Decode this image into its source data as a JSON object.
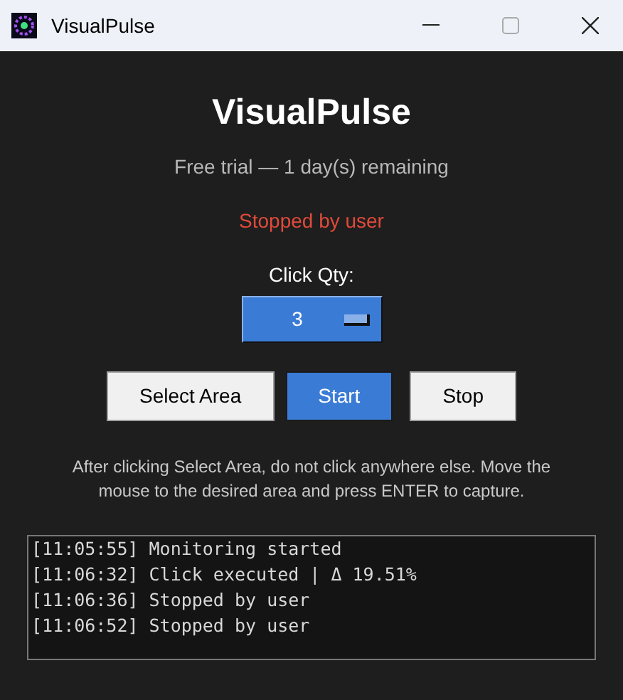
{
  "window": {
    "title": "VisualPulse"
  },
  "app_title": "VisualPulse",
  "trial": "Free trial — 1 day(s) remaining",
  "status": "Stopped by user",
  "click_qty": {
    "label": "Click Qty:",
    "value": "3"
  },
  "buttons": [
    {
      "label": "Select Area",
      "kind": "plain"
    },
    {
      "label": "Start",
      "kind": "primary"
    },
    {
      "label": "Stop",
      "kind": "plain"
    }
  ],
  "instructions": "After clicking Select Area, do not click anywhere else. Move the mouse to the desired area and press ENTER to capture.",
  "log": [
    "[11:05:55] Monitoring started",
    "[11:06:32] Click executed | Δ 19.51%",
    "[11:06:36] Stopped by user",
    "[11:06:52] Stopped by user"
  ]
}
